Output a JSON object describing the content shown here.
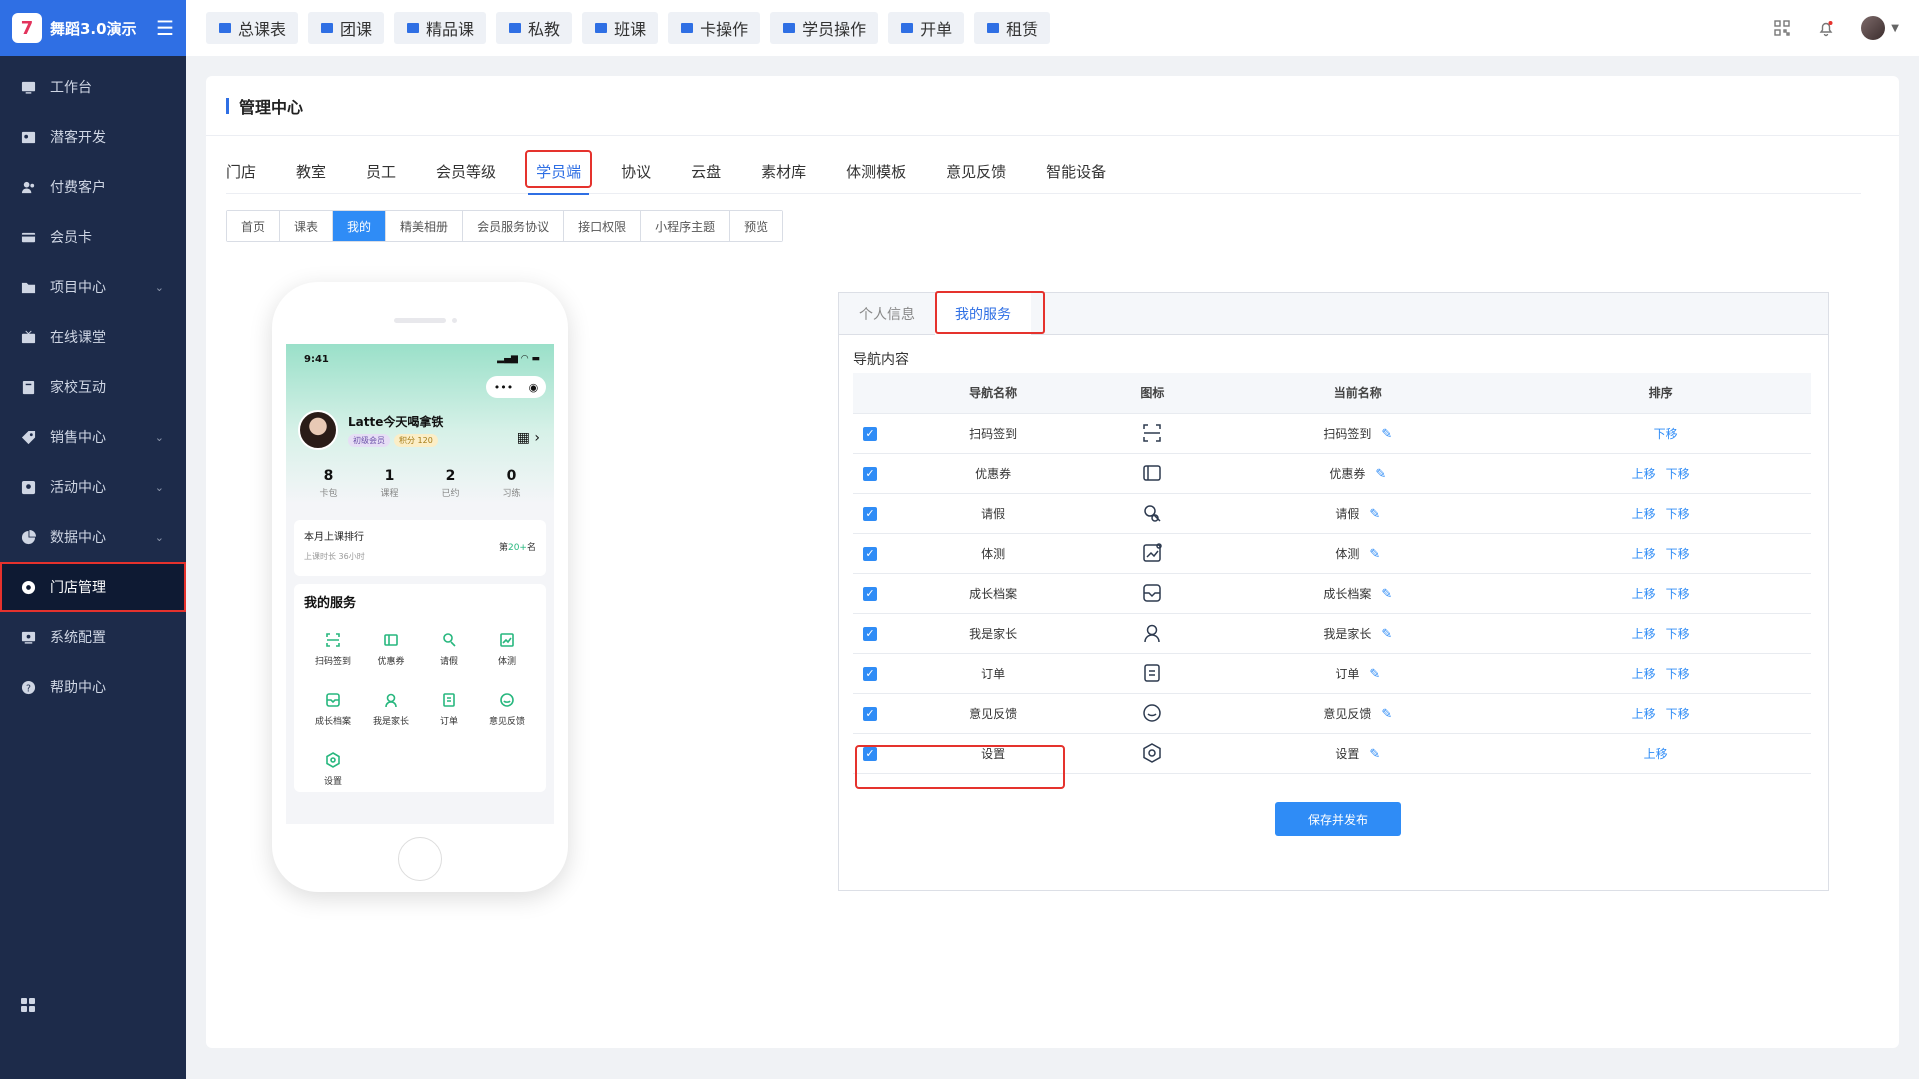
{
  "brand": {
    "title": "舞蹈3.0演示"
  },
  "sidebar": {
    "items": [
      {
        "label": "工作台",
        "icon": "dashboard-icon",
        "chevron": false
      },
      {
        "label": "潜客开发",
        "icon": "contact-card-icon",
        "chevron": false
      },
      {
        "label": "付费客户",
        "icon": "users-icon",
        "chevron": false
      },
      {
        "label": "会员卡",
        "icon": "card-icon",
        "chevron": false
      },
      {
        "label": "项目中心",
        "icon": "folder-icon",
        "chevron": true
      },
      {
        "label": "在线课堂",
        "icon": "tv-icon",
        "chevron": false
      },
      {
        "label": "家校互动",
        "icon": "book-icon",
        "chevron": false
      },
      {
        "label": "销售中心",
        "icon": "tag-icon",
        "chevron": true
      },
      {
        "label": "活动中心",
        "icon": "activity-icon",
        "chevron": true
      },
      {
        "label": "数据中心",
        "icon": "pie-chart-icon",
        "chevron": true
      },
      {
        "label": "门店管理",
        "icon": "store-icon",
        "chevron": false,
        "active": true
      },
      {
        "label": "系统配置",
        "icon": "monitor-icon",
        "chevron": false
      },
      {
        "label": "帮助中心",
        "icon": "help-icon",
        "chevron": false
      }
    ]
  },
  "topbar": {
    "buttons": [
      "总课表",
      "团课",
      "精品课",
      "私教",
      "班课",
      "卡操作",
      "学员操作",
      "开单",
      "租赁"
    ]
  },
  "card": {
    "title": "管理中心"
  },
  "tabs1": [
    "门店",
    "教室",
    "员工",
    "会员等级",
    "学员端",
    "协议",
    "云盘",
    "素材库",
    "体测模板",
    "意见反馈",
    "智能设备"
  ],
  "tabs2": [
    "首页",
    "课表",
    "我的",
    "精美相册",
    "会员服务协议",
    "接口权限",
    "小程序主题",
    "预览"
  ],
  "phone": {
    "time": "9:41",
    "user_name": "Latte今天喝拿铁",
    "badge_level": "初级会员",
    "badge_points": "积分 120",
    "stats": [
      {
        "value": "8",
        "label": "卡包"
      },
      {
        "value": "1",
        "label": "课程"
      },
      {
        "value": "2",
        "label": "已约"
      },
      {
        "value": "0",
        "label": "习练"
      }
    ],
    "rank_title": "本月上课排行",
    "rank_sub": "上课时长 36小时",
    "rank_prefix": "第",
    "rank_value": "20+",
    "rank_suffix": "名",
    "services_title": "我的服务",
    "services": [
      "扫码签到",
      "优惠券",
      "请假",
      "体测",
      "成长档案",
      "我是家长",
      "订单",
      "意见反馈",
      "设置"
    ]
  },
  "panel": {
    "tabs": [
      "个人信息",
      "我的服务"
    ],
    "section_label": "导航内容",
    "headers": [
      "导航名称",
      "图标",
      "当前名称",
      "排序"
    ],
    "rows": [
      {
        "name": "扫码签到",
        "current": "扫码签到",
        "up": "",
        "down": "下移",
        "icon": "scan-icon"
      },
      {
        "name": "优惠券",
        "current": "优惠券",
        "up": "上移",
        "down": "下移",
        "icon": "coupon-icon"
      },
      {
        "name": "请假",
        "current": "请假",
        "up": "上移",
        "down": "下移",
        "icon": "leave-icon"
      },
      {
        "name": "体测",
        "current": "体测",
        "up": "上移",
        "down": "下移",
        "icon": "body-test-icon"
      },
      {
        "name": "成长档案",
        "current": "成长档案",
        "up": "上移",
        "down": "下移",
        "icon": "archive-icon"
      },
      {
        "name": "我是家长",
        "current": "我是家长",
        "up": "上移",
        "down": "下移",
        "icon": "parent-icon"
      },
      {
        "name": "订单",
        "current": "订单",
        "up": "上移",
        "down": "下移",
        "icon": "order-icon"
      },
      {
        "name": "意见反馈",
        "current": "意见反馈",
        "up": "上移",
        "down": "下移",
        "icon": "feedback-icon"
      },
      {
        "name": "设置",
        "current": "设置",
        "up": "上移",
        "down": "",
        "icon": "settings-icon"
      }
    ],
    "save_label": "保存并发布"
  },
  "colors": {
    "primary": "#2f6fe4",
    "sidebar": "#1d2b4a",
    "highlight": "#e5322d",
    "accent_green": "#27b77e"
  }
}
